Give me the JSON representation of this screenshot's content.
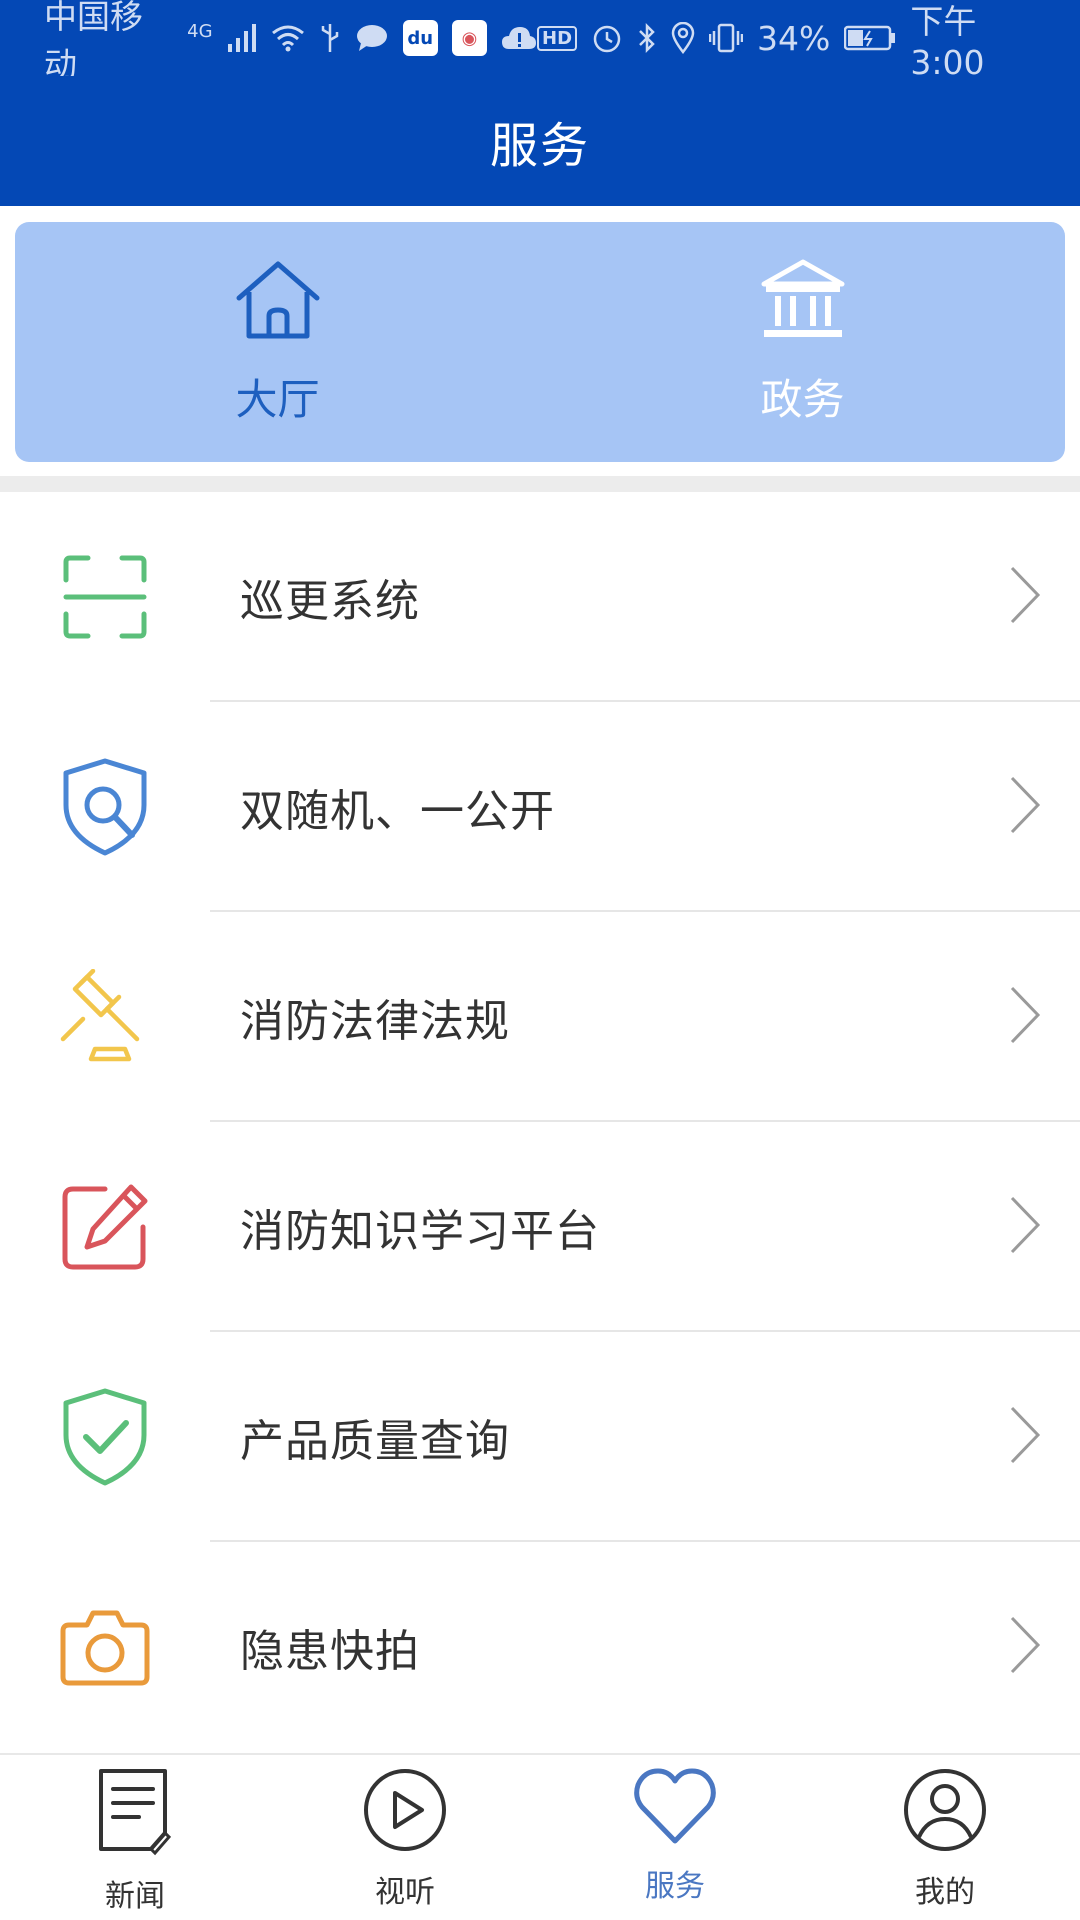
{
  "status_bar": {
    "carrier": "中国移动",
    "network": "4G",
    "battery_percent": "34%",
    "time": "下午3:00",
    "hd_badge": "HD",
    "icons": [
      "signal-icon",
      "wifi-icon",
      "usb-icon",
      "message-icon",
      "baidu-icon",
      "map-icon",
      "cloud-icon",
      "alarm-icon",
      "bluetooth-icon",
      "location-icon",
      "vibrate-icon",
      "battery-icon"
    ]
  },
  "header": {
    "title": "服务"
  },
  "segments": [
    {
      "label": "大厅",
      "icon": "home-icon",
      "active": true
    },
    {
      "label": "政务",
      "icon": "government-building-icon",
      "active": false
    }
  ],
  "menu": [
    {
      "label": "巡更系统",
      "icon": "scan-frame-icon",
      "color": "#5bbf7a"
    },
    {
      "label": "双随机、一公开",
      "icon": "shield-search-icon",
      "color": "#4a86d4"
    },
    {
      "label": "消防法律法规",
      "icon": "gavel-icon",
      "color": "#f2c64c"
    },
    {
      "label": "消防知识学习平台",
      "icon": "edit-pencil-icon",
      "color": "#d9555b"
    },
    {
      "label": "产品质量查询",
      "icon": "shield-check-icon",
      "color": "#5bbf7a"
    },
    {
      "label": "隐患快拍",
      "icon": "camera-icon",
      "color": "#e99a3b"
    }
  ],
  "tabs": [
    {
      "label": "新闻",
      "icon": "news-icon",
      "active": false
    },
    {
      "label": "视听",
      "icon": "play-icon",
      "active": false
    },
    {
      "label": "服务",
      "icon": "heart-icon",
      "active": true
    },
    {
      "label": "我的",
      "icon": "profile-icon",
      "active": false
    }
  ],
  "colors": {
    "primary": "#0448b5",
    "segment_bg": "#a6c5f5",
    "active_tab": "#4a77c2"
  }
}
